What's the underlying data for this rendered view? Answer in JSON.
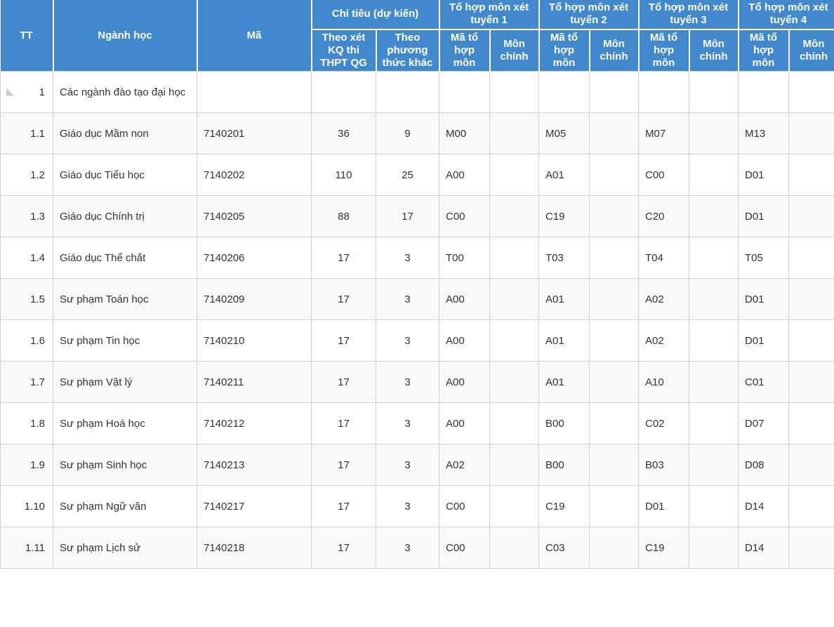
{
  "table": {
    "header": {
      "tt": "TT",
      "nganh_hoc": "Ngành học",
      "ma": "Mã",
      "chi_tieu": "Chỉ tiêu (dự kiến)",
      "theo_xet_kq": "Theo xét KQ thi THPT QG",
      "theo_phuong_thuc_khac": "Theo phương thức khác",
      "to_hop_1": "Tổ hợp môn xét tuyển 1",
      "to_hop_2": "Tổ hợp môn xét tuyển 2",
      "to_hop_3": "Tổ hợp môn xét tuyển 3",
      "to_hop_4": "Tổ hợp môn xét tuyển 4",
      "ma_to_hop_mon": "Mã tổ hợp môn",
      "mon_chinh": "Môn chính"
    },
    "colors": {
      "header_bg": "#4189CC",
      "header_text": "#ffffff",
      "row_odd_bg": "#ffffff",
      "row_even_bg": "#f8f8f8",
      "border": "#d2d0d0",
      "body_text": "#333333",
      "toggle_icon": "#b9cfe4"
    },
    "icons": {
      "collapse_toggle": "triangle-collapse-icon"
    },
    "rows": [
      {
        "type": "group",
        "tt": "1",
        "nganh_hoc": "Các ngành đào tạo đại học",
        "ma": "",
        "theo_xet_kq": "",
        "theo_phuong_thuc_khac": "",
        "ma1": "",
        "mon1": "",
        "ma2": "",
        "mon2": "",
        "ma3": "",
        "mon3": "",
        "ma4": "",
        "mon4": ""
      },
      {
        "type": "item",
        "tt": "1.1",
        "nganh_hoc": "Giáo dục Mầm non",
        "ma": "7140201",
        "theo_xet_kq": "36",
        "theo_phuong_thuc_khac": "9",
        "ma1": "M00",
        "mon1": "",
        "ma2": "M05",
        "mon2": "",
        "ma3": "M07",
        "mon3": "",
        "ma4": "M13",
        "mon4": ""
      },
      {
        "type": "item",
        "tt": "1.2",
        "nganh_hoc": "Giáo dục Tiểu học",
        "ma": "7140202",
        "theo_xet_kq": "110",
        "theo_phuong_thuc_khac": "25",
        "ma1": "A00",
        "mon1": "",
        "ma2": "A01",
        "mon2": "",
        "ma3": "C00",
        "mon3": "",
        "ma4": "D01",
        "mon4": ""
      },
      {
        "type": "item",
        "tt": "1.3",
        "nganh_hoc": "Giáo dục Chính trị",
        "ma": "7140205",
        "theo_xet_kq": "88",
        "theo_phuong_thuc_khac": "17",
        "ma1": "C00",
        "mon1": "",
        "ma2": "C19",
        "mon2": "",
        "ma3": "C20",
        "mon3": "",
        "ma4": "D01",
        "mon4": ""
      },
      {
        "type": "item",
        "tt": "1.4",
        "nganh_hoc": "Giáo dục Thể chất",
        "ma": "7140206",
        "theo_xet_kq": "17",
        "theo_phuong_thuc_khac": "3",
        "ma1": "T00",
        "mon1": "",
        "ma2": "T03",
        "mon2": "",
        "ma3": "T04",
        "mon3": "",
        "ma4": "T05",
        "mon4": ""
      },
      {
        "type": "item",
        "tt": "1.5",
        "nganh_hoc": "Sư phạm Toán học",
        "ma": "7140209",
        "theo_xet_kq": "17",
        "theo_phuong_thuc_khac": "3",
        "ma1": "A00",
        "mon1": "",
        "ma2": "A01",
        "mon2": "",
        "ma3": "A02",
        "mon3": "",
        "ma4": "D01",
        "mon4": ""
      },
      {
        "type": "item",
        "tt": "1.6",
        "nganh_hoc": "Sư phạm Tin học",
        "ma": "7140210",
        "theo_xet_kq": "17",
        "theo_phuong_thuc_khac": "3",
        "ma1": "A00",
        "mon1": "",
        "ma2": "A01",
        "mon2": "",
        "ma3": "A02",
        "mon3": "",
        "ma4": "D01",
        "mon4": ""
      },
      {
        "type": "item",
        "tt": "1.7",
        "nganh_hoc": "Sư phạm Vật lý",
        "ma": "7140211",
        "theo_xet_kq": "17",
        "theo_phuong_thuc_khac": "3",
        "ma1": "A00",
        "mon1": "",
        "ma2": "A01",
        "mon2": "",
        "ma3": "A10",
        "mon3": "",
        "ma4": "C01",
        "mon4": ""
      },
      {
        "type": "item",
        "tt": "1.8",
        "nganh_hoc": "Sư phạm Hoá học",
        "ma": "7140212",
        "theo_xet_kq": "17",
        "theo_phuong_thuc_khac": "3",
        "ma1": "A00",
        "mon1": "",
        "ma2": "B00",
        "mon2": "",
        "ma3": "C02",
        "mon3": "",
        "ma4": "D07",
        "mon4": ""
      },
      {
        "type": "item",
        "tt": "1.9",
        "nganh_hoc": "Sư phạm Sinh học",
        "ma": "7140213",
        "theo_xet_kq": "17",
        "theo_phuong_thuc_khac": "3",
        "ma1": "A02",
        "mon1": "",
        "ma2": "B00",
        "mon2": "",
        "ma3": "B03",
        "mon3": "",
        "ma4": "D08",
        "mon4": ""
      },
      {
        "type": "item",
        "tt": "1.10",
        "nganh_hoc": "Sư phạm Ngữ văn",
        "ma": "7140217",
        "theo_xet_kq": "17",
        "theo_phuong_thuc_khac": "3",
        "ma1": "C00",
        "mon1": "",
        "ma2": "C19",
        "mon2": "",
        "ma3": "D01",
        "mon3": "",
        "ma4": "D14",
        "mon4": ""
      },
      {
        "type": "item",
        "tt": "1.11",
        "nganh_hoc": "Sư phạm Lịch sử",
        "ma": "7140218",
        "theo_xet_kq": "17",
        "theo_phuong_thuc_khac": "3",
        "ma1": "C00",
        "mon1": "",
        "ma2": "C03",
        "mon2": "",
        "ma3": "C19",
        "mon3": "",
        "ma4": "D14",
        "mon4": ""
      }
    ]
  }
}
